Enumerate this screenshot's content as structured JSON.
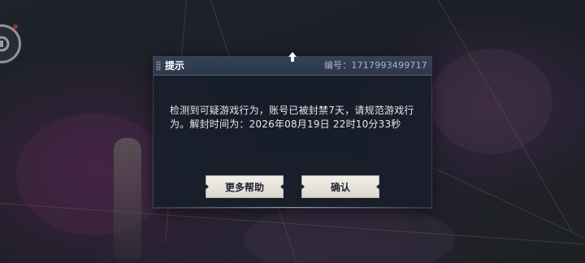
{
  "dialog": {
    "title": "提示",
    "id_label": "编号：1717993499717",
    "message": "检测到可疑游戏行为，账号已被封禁7天，请规范游戏行为。解封时间为：2026年08月19日 22时10分33秒",
    "help_button": "更多帮助",
    "confirm_button": "确认"
  },
  "icons": {
    "corner": "game-menu-icon",
    "pin": "pin-icon",
    "grip": "drag-grip-icon"
  },
  "colors": {
    "notification_dot": "#e0452f",
    "dialog_bg": "#181e2a",
    "button_bg": "#f1eee7"
  }
}
